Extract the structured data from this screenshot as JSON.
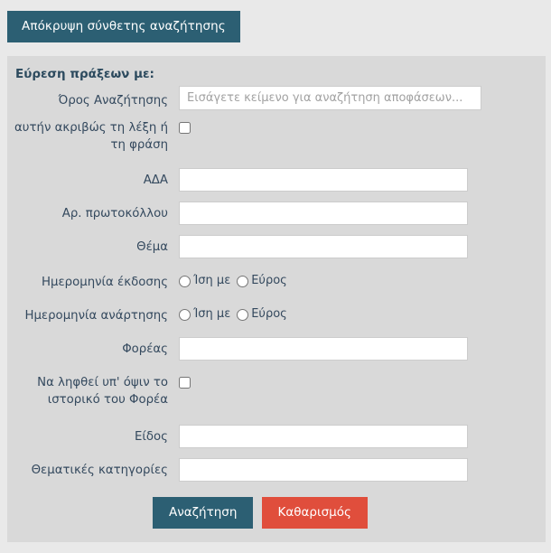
{
  "toggle": {
    "label": "Απόκρυψη σύνθετης αναζήτησης"
  },
  "panel": {
    "title": "Εύρεση πράξεων με:"
  },
  "fields": {
    "search_term": {
      "label": "Όρος Αναζήτησης",
      "placeholder": "Εισάγετε κείμενο για αναζήτηση αποφάσεων...",
      "value": ""
    },
    "exact_phrase": {
      "label": "αυτήν ακριβώς τη λέξη ή τη φράση",
      "label_line1": "αυτήν ακριβώς τη λέξη ή",
      "label_line2": "τη φράση",
      "checked": false
    },
    "ada": {
      "label": "ΑΔΑ",
      "value": ""
    },
    "protocol_number": {
      "label": "Αρ. πρωτοκόλλου",
      "value": ""
    },
    "subject": {
      "label": "Θέμα",
      "value": ""
    },
    "issue_date": {
      "label": "Ημερομηνία έκδοσης",
      "options": [
        "Ίση με",
        "Εύρος"
      ],
      "selected": null
    },
    "publish_date": {
      "label": "Ημερομηνία ανάρτησης",
      "options": [
        "Ίση με",
        "Εύρος"
      ],
      "selected": null
    },
    "organization": {
      "label": "Φορέας",
      "value": ""
    },
    "org_history": {
      "label": "Να ληφθεί υπ' όψιν το ιστορικό του Φορέα",
      "label_line1": "Να ληφθεί υπ' όψιν το",
      "label_line2": "ιστορικό του Φορέα",
      "checked": false
    },
    "type": {
      "label": "Είδος",
      "value": ""
    },
    "thematic_categories": {
      "label": "Θεματικές κατηγορίες",
      "value": ""
    }
  },
  "actions": {
    "search_label": "Αναζήτηση",
    "clear_label": "Καθαρισμός"
  },
  "colors": {
    "primary": "#2c5f73",
    "danger": "#e04e3c",
    "panel_bg": "#d9d9d9",
    "page_bg": "#e9e9e9",
    "text": "#34495e"
  }
}
